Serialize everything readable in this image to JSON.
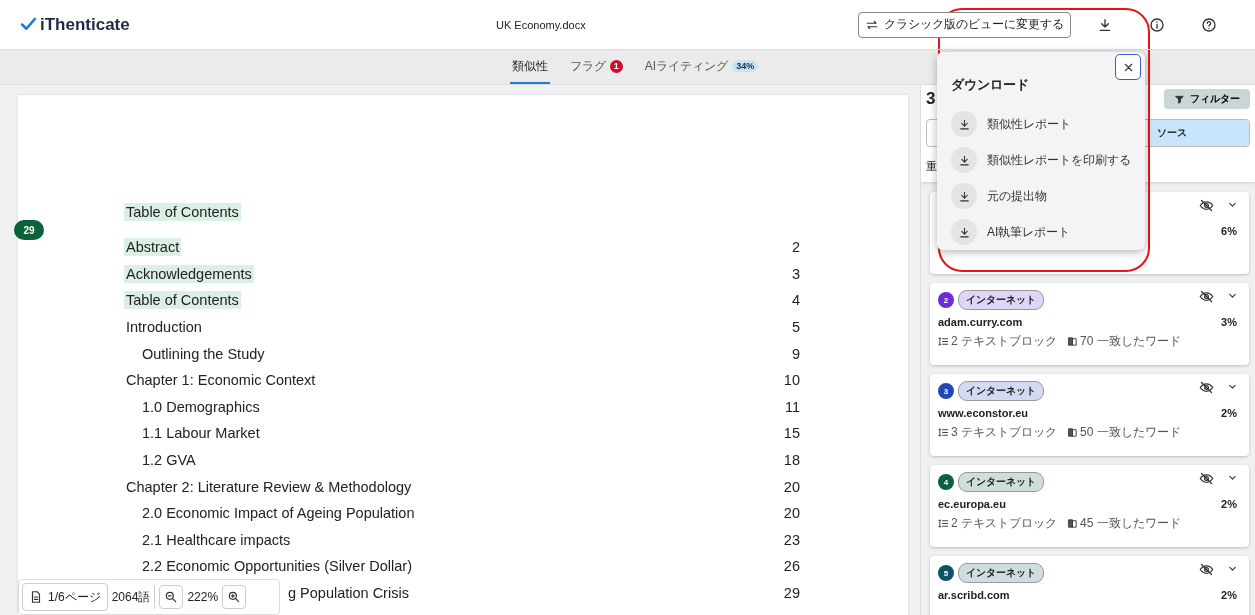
{
  "app": {
    "logo": "iThenticate",
    "file_name": "UK Economy.docx",
    "classic_view_button": "クラシック版のビューに変更する"
  },
  "tabs": [
    {
      "label": "類似性",
      "selected": true
    },
    {
      "label": "フラグ",
      "selected": false,
      "badge": "1"
    },
    {
      "label": "AIライティング",
      "selected": false,
      "badge": "34%"
    }
  ],
  "document": {
    "match_marker": "29",
    "title": {
      "text": "Table of Contents",
      "highlighted": true
    },
    "lines": [
      {
        "text": "Abstract",
        "page": "2",
        "highlighted": true
      },
      {
        "text": "Acknowledgements",
        "page": "3",
        "highlighted": true
      },
      {
        "text": "Table of Contents",
        "page": "4",
        "highlighted": true
      },
      {
        "text": "Introduction",
        "page": "5",
        "highlighted": false,
        "children": [
          {
            "text": "Outlining the Study",
            "page": "9",
            "highlighted": false
          }
        ]
      },
      {
        "text": "Chapter 1: Economic Context",
        "page": "10",
        "highlighted": false,
        "children": [
          {
            "text": "1.0 Demographics",
            "page": "11",
            "highlighted": false
          },
          {
            "text": "1.1 Labour Market",
            "page": "15",
            "highlighted": false
          },
          {
            "text": "1.2 GVA",
            "page": "18",
            "highlighted": false
          }
        ]
      },
      {
        "text": "Chapter 2: Literature Review & Methodology",
        "page": "20",
        "highlighted": false,
        "children": [
          {
            "text": "2.0 Economic Impact of Ageing Population",
            "page": "20",
            "highlighted": false
          },
          {
            "text": "2.1 Healthcare impacts",
            "page": "23",
            "highlighted": false
          },
          {
            "text": "2.2 Economic Opportunities (Silver Dollar)",
            "page": "26",
            "highlighted": false
          },
          {
            "text": "g Population Crisis",
            "page": "29",
            "highlighted": false,
            "kind": "partial"
          }
        ]
      }
    ],
    "toolbar": {
      "page": "1/6ページ",
      "words": "2064語",
      "zoom": "222%"
    }
  },
  "sources": {
    "count": "3",
    "filter_button": "フィルター",
    "segments": [
      {
        "label": "ソース",
        "selected": true
      }
    ],
    "sort_label": "重",
    "cards": [
      {
        "percent": "6%"
      },
      {
        "number": "2",
        "color": "#6a2bd9",
        "tag": "インターネット",
        "name": "adam.curry.com",
        "percent": "3%",
        "blocks": "2 テキストブロック",
        "words": "70 一致したワード"
      },
      {
        "number": "3",
        "color": "#2447b8",
        "tag": "インターネット",
        "name": "www.econstor.eu",
        "percent": "2%",
        "blocks": "3 テキストブロック",
        "words": "50 一致したワード"
      },
      {
        "number": "4",
        "color": "#0b6138",
        "tag": "インターネット",
        "name": "ec.europa.eu",
        "percent": "2%",
        "blocks": "2 テキストブロック",
        "words": "45 一致したワード"
      },
      {
        "number": "5",
        "color": "#0b5566",
        "tag": "インターネット",
        "name": "ar.scribd.com",
        "percent": "2%"
      }
    ]
  },
  "download_popup": {
    "title": "ダウンロード",
    "items": [
      "類似性レポート",
      "類似性レポートを印刷する",
      "元の提出物",
      "AI執筆レポート"
    ]
  }
}
